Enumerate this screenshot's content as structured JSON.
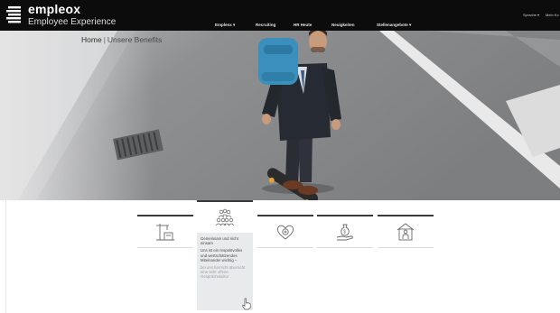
{
  "header": {
    "brand": "empleox",
    "tagline": "Employee Experience",
    "nav": [
      {
        "label": "Empleox"
      },
      {
        "label": "Recruiting"
      },
      {
        "label": "HR Heute"
      },
      {
        "label": "Neuigkeiten"
      },
      {
        "label": "Stellenangebote"
      }
    ],
    "right": {
      "language": "Sprache",
      "account": "Mein Ko"
    }
  },
  "breadcrumb": {
    "home": "Home",
    "separator": "|",
    "current": "Unsere Benefits"
  },
  "benefits": {
    "tiles": [
      {
        "icon": "crane-building-icon",
        "active": false
      },
      {
        "icon": "people-group-icon",
        "active": true
      },
      {
        "icon": "heart-plus-icon",
        "active": false
      },
      {
        "icon": "money-hand-icon",
        "active": false
      },
      {
        "icon": "house-person-icon",
        "active": false
      }
    ],
    "popup": {
      "title": "Gemeinsam und nicht einsam",
      "text": "Uns ist ein respektvolles und wertschätzendes Miteinander wichtig –",
      "faded": "bei uns herrscht übersicht eine sehr offene Gesprächskultur"
    }
  },
  "colors": {
    "topbar": "#0c0c0c",
    "popup_bg": "#e9eaeb",
    "accent_dark": "#3a3a3a"
  }
}
